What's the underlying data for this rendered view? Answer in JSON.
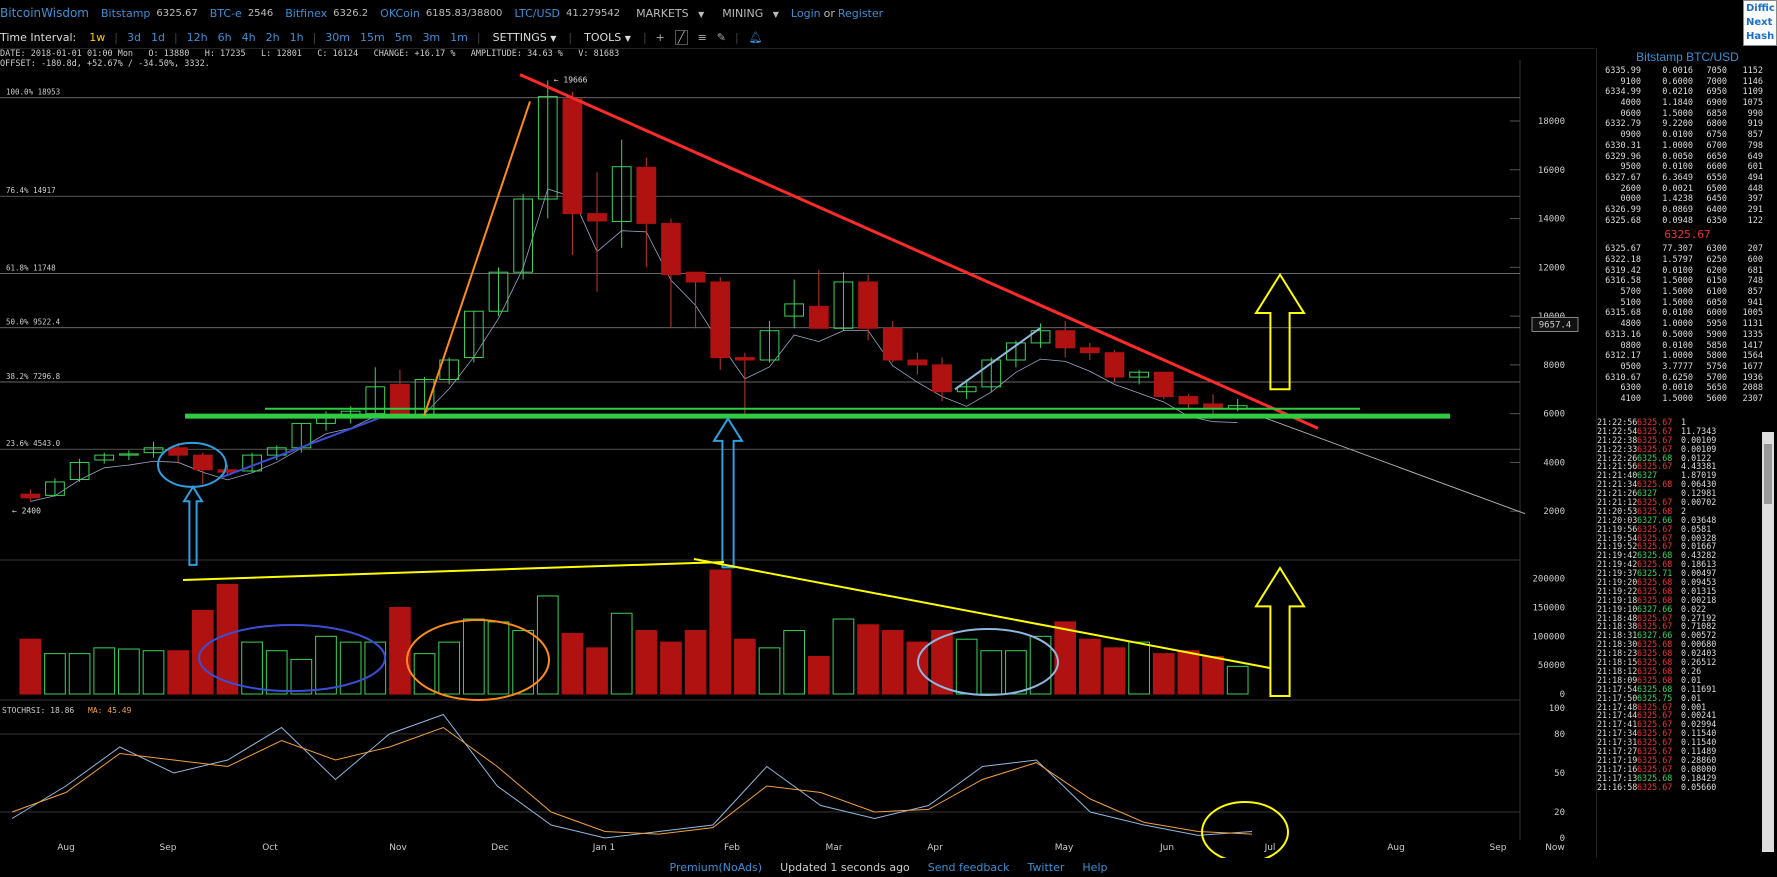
{
  "topbar": {
    "brand": "BitcoinWisdom",
    "tickers": [
      {
        "label": "Bitstamp",
        "value": "6325.67"
      },
      {
        "label": "BTC-e",
        "value": "2546"
      },
      {
        "label": "Bitfinex",
        "value": "6326.2"
      },
      {
        "label": "OKCoin",
        "value": "6185.83/38800"
      },
      {
        "label": "LTC/USD",
        "value": "41.279542"
      }
    ],
    "menu_markets": "MARKETS",
    "menu_mining": "MINING",
    "login": "Login",
    "or": "or",
    "register": "Register"
  },
  "corner": [
    "Diffic",
    "Next",
    "Hash"
  ],
  "toolbar": {
    "label": "Time Interval:",
    "intervals": [
      "1w",
      "3d",
      "1d",
      "12h",
      "6h",
      "4h",
      "2h",
      "1h",
      "30m",
      "15m",
      "5m",
      "3m",
      "1m"
    ],
    "selected": "1w",
    "settings": "SETTINGS",
    "tools": "TOOLS"
  },
  "info": {
    "line1": "DATE: 2018-01-01 01:00 Mon   O: 13880   H: 17235   L: 12801   C: 16124   CHANGE: +16.17 %   AMPLITUDE: 34.63 %   V: 81683",
    "line2": "OFFSET: -180.8d, +52.67% / -34.50%, 3332."
  },
  "chart_data": [
    {
      "type": "candlestick",
      "title": "Bitstamp BTC/USD 1w",
      "x_labels": [
        "Aug",
        "Sep",
        "Oct",
        "Nov",
        "Dec",
        "Jan 1",
        "Feb",
        "Mar",
        "Apr",
        "May",
        "Jun",
        "Jul",
        "Aug",
        "Sep",
        "Now"
      ],
      "y_ticks": [
        2000,
        4000,
        6000,
        8000,
        10000,
        12000,
        14000,
        16000,
        18000
      ],
      "ylim": [
        0,
        20500
      ],
      "max_label": "19666",
      "min_label": "2400",
      "current_price_tag": "9657.4",
      "fib_levels": [
        {
          "label": "100.0% 18953",
          "value": 18953
        },
        {
          "label": "76.4% 14917",
          "value": 14917
        },
        {
          "label": "61.8% 11748",
          "value": 11748
        },
        {
          "label": "50.0% 9522.4",
          "value": 9522.4
        },
        {
          "label": "38.2% 7296.8",
          "value": 7296.8
        },
        {
          "label": "23.6% 4543.0",
          "value": 4543.0
        }
      ],
      "candles": [
        {
          "o": 2700,
          "h": 2900,
          "l": 2400,
          "c": 2550
        },
        {
          "o": 2650,
          "h": 3350,
          "l": 2600,
          "c": 3200
        },
        {
          "o": 3300,
          "h": 4150,
          "l": 3200,
          "c": 4000
        },
        {
          "o": 4100,
          "h": 4400,
          "l": 3950,
          "c": 4300
        },
        {
          "o": 4300,
          "h": 4500,
          "l": 4100,
          "c": 4350
        },
        {
          "o": 4400,
          "h": 4850,
          "l": 4200,
          "c": 4600
        },
        {
          "o": 4600,
          "h": 4800,
          "l": 3950,
          "c": 4300
        },
        {
          "o": 4300,
          "h": 4400,
          "l": 3100,
          "c": 3700
        },
        {
          "o": 3700,
          "h": 3900,
          "l": 3500,
          "c": 3600
        },
        {
          "o": 3650,
          "h": 4400,
          "l": 3600,
          "c": 4300
        },
        {
          "o": 4300,
          "h": 4700,
          "l": 4100,
          "c": 4600
        },
        {
          "o": 4600,
          "h": 5600,
          "l": 4400,
          "c": 5600
        },
        {
          "o": 5600,
          "h": 6100,
          "l": 5300,
          "c": 5900
        },
        {
          "o": 5900,
          "h": 6300,
          "l": 5600,
          "c": 6100
        },
        {
          "o": 6000,
          "h": 7900,
          "l": 5900,
          "c": 7100
        },
        {
          "o": 7200,
          "h": 7800,
          "l": 5900,
          "c": 5900
        },
        {
          "o": 5900,
          "h": 7500,
          "l": 5800,
          "c": 7400
        },
        {
          "o": 7400,
          "h": 8300,
          "l": 7200,
          "c": 8200
        },
        {
          "o": 8300,
          "h": 10200,
          "l": 8100,
          "c": 10200
        },
        {
          "o": 10200,
          "h": 12000,
          "l": 10000,
          "c": 11800
        },
        {
          "o": 11800,
          "h": 15000,
          "l": 11500,
          "c": 14800
        },
        {
          "o": 14800,
          "h": 19666,
          "l": 14000,
          "c": 19000
        },
        {
          "o": 18900,
          "h": 19200,
          "l": 12500,
          "c": 14200
        },
        {
          "o": 14200,
          "h": 15900,
          "l": 11000,
          "c": 13900
        },
        {
          "o": 13880,
          "h": 17235,
          "l": 12801,
          "c": 16124
        },
        {
          "o": 16100,
          "h": 16500,
          "l": 12000,
          "c": 13800
        },
        {
          "o": 13800,
          "h": 14000,
          "l": 9500,
          "c": 11700
        },
        {
          "o": 11800,
          "h": 11800,
          "l": 9500,
          "c": 11400
        },
        {
          "o": 11400,
          "h": 11600,
          "l": 7800,
          "c": 8300
        },
        {
          "o": 8300,
          "h": 8500,
          "l": 6000,
          "c": 8200
        },
        {
          "o": 8200,
          "h": 9800,
          "l": 8100,
          "c": 9400
        },
        {
          "o": 10000,
          "h": 11500,
          "l": 9500,
          "c": 10500
        },
        {
          "o": 10400,
          "h": 11900,
          "l": 9600,
          "c": 9500
        },
        {
          "o": 9500,
          "h": 11800,
          "l": 9400,
          "c": 11400
        },
        {
          "o": 11400,
          "h": 11700,
          "l": 9000,
          "c": 9500
        },
        {
          "o": 9500,
          "h": 9800,
          "l": 8100,
          "c": 8200
        },
        {
          "o": 8200,
          "h": 8500,
          "l": 7600,
          "c": 8000
        },
        {
          "o": 8000,
          "h": 8300,
          "l": 6500,
          "c": 6900
        },
        {
          "o": 6900,
          "h": 7400,
          "l": 6600,
          "c": 7100
        },
        {
          "o": 7100,
          "h": 8300,
          "l": 6900,
          "c": 8200
        },
        {
          "o": 8200,
          "h": 9000,
          "l": 7900,
          "c": 8900
        },
        {
          "o": 8900,
          "h": 9700,
          "l": 8700,
          "c": 9400
        },
        {
          "o": 9400,
          "h": 9800,
          "l": 8300,
          "c": 8700
        },
        {
          "o": 8700,
          "h": 8900,
          "l": 8200,
          "c": 8500
        },
        {
          "o": 8500,
          "h": 8600,
          "l": 7300,
          "c": 7500
        },
        {
          "o": 7500,
          "h": 7800,
          "l": 7200,
          "c": 7700
        },
        {
          "o": 7700,
          "h": 7700,
          "l": 6600,
          "c": 6700
        },
        {
          "o": 6700,
          "h": 6800,
          "l": 6200,
          "c": 6400
        },
        {
          "o": 6400,
          "h": 6800,
          "l": 5800,
          "c": 6200
        },
        {
          "o": 6200,
          "h": 6600,
          "l": 6100,
          "c": 6325
        }
      ],
      "volume": {
        "y_ticks": [
          0,
          50000,
          100000,
          150000,
          200000
        ],
        "ylim": [
          0,
          215000
        ],
        "bars": [
          95000,
          70000,
          70000,
          80000,
          78000,
          75000,
          75000,
          145000,
          190000,
          90000,
          75000,
          60000,
          100000,
          90000,
          90000,
          150000,
          70000,
          90000,
          130000,
          125000,
          110000,
          170000,
          105000,
          80000,
          140000,
          110000,
          90000,
          110000,
          215000,
          95000,
          80000,
          110000,
          65000,
          130000,
          120000,
          110000,
          90000,
          110000,
          95000,
          75000,
          75000,
          100000,
          125000,
          95000,
          80000,
          90000,
          70000,
          75000,
          65000,
          48000
        ]
      },
      "stochrsi": {
        "label": "STOCHRSI: 18.86",
        "ma_label": "MA: 45.49",
        "y_ticks": [
          0,
          20,
          50,
          80,
          100
        ],
        "k": [
          15,
          40,
          70,
          50,
          60,
          85,
          45,
          80,
          95,
          40,
          10,
          0,
          5,
          10,
          55,
          25,
          15,
          25,
          55,
          60,
          20,
          10,
          2,
          5
        ],
        "d": [
          20,
          35,
          65,
          60,
          55,
          75,
          60,
          70,
          85,
          55,
          20,
          5,
          3,
          8,
          40,
          35,
          20,
          22,
          45,
          58,
          30,
          12,
          5,
          3
        ]
      }
    }
  ],
  "right_panel": {
    "title": "Bitstamp BTC/USD",
    "asks": [
      [
        "6335.99",
        "0.0016",
        "7050",
        "1152"
      ],
      [
        "9100",
        "0.6000",
        "7000",
        "1146"
      ],
      [
        "6334.99",
        "0.0210",
        "6950",
        "1109"
      ],
      [
        "4000",
        "1.1840",
        "6900",
        "1075"
      ],
      [
        "0600",
        "1.5000",
        "6850",
        "990"
      ],
      [
        "6332.79",
        "9.2200",
        "6800",
        "919"
      ],
      [
        "0900",
        "0.0100",
        "6750",
        "857"
      ],
      [
        "6330.31",
        "1.0000",
        "6700",
        "798"
      ],
      [
        "6329.96",
        "0.0050",
        "6650",
        "649"
      ],
      [
        "9500",
        "0.0100",
        "6600",
        "601"
      ],
      [
        "6327.67",
        "6.3649",
        "6550",
        "494"
      ],
      [
        "2600",
        "0.0021",
        "6500",
        "448"
      ],
      [
        "0000",
        "1.4238",
        "6450",
        "397"
      ],
      [
        "6326.99",
        "0.0869",
        "6400",
        "291"
      ],
      [
        "6325.68",
        "0.0948",
        "6350",
        "122"
      ]
    ],
    "last_price": "6325.67",
    "bids": [
      [
        "6325.67",
        "77.307",
        "6300",
        "207"
      ],
      [
        "6322.18",
        "1.5797",
        "6250",
        "600"
      ],
      [
        "6319.42",
        "0.0100",
        "6200",
        "681"
      ],
      [
        "6316.58",
        "1.5000",
        "6150",
        "748"
      ],
      [
        "5700",
        "1.5000",
        "6100",
        "857"
      ],
      [
        "5100",
        "1.5000",
        "6050",
        "941"
      ],
      [
        "6315.68",
        "0.0100",
        "6000",
        "1005"
      ],
      [
        "4800",
        "1.0000",
        "5950",
        "1131"
      ],
      [
        "6313.16",
        "0.5000",
        "5900",
        "1335"
      ],
      [
        "0800",
        "0.0100",
        "5850",
        "1417"
      ],
      [
        "6312.17",
        "1.0000",
        "5800",
        "1564"
      ],
      [
        "0500",
        "3.7777",
        "5750",
        "1677"
      ],
      [
        "6310.67",
        "0.6250",
        "5700",
        "1936"
      ],
      [
        "6300",
        "0.0010",
        "5650",
        "2088"
      ],
      [
        "4100",
        "1.5000",
        "5600",
        "2307"
      ]
    ],
    "trades": [
      [
        "21:22:56",
        "6325.67",
        "1",
        "dn"
      ],
      [
        "21:22:54",
        "6325.67",
        "11.7343",
        "dn"
      ],
      [
        "21:22:38",
        "6325.67",
        "0.00109",
        "dn"
      ],
      [
        "21:22:33",
        "6325.67",
        "0.00109",
        "dn"
      ],
      [
        "21:22:26",
        "6325.68",
        "0.0122",
        "up"
      ],
      [
        "21:21:56",
        "6325.67",
        "4.43381",
        "dn"
      ],
      [
        "21:21:40",
        "6327",
        "1.87019",
        "up"
      ],
      [
        "21:21:34",
        "6325.68",
        "0.06430",
        "dn"
      ],
      [
        "21:21:26",
        "6327",
        "0.12981",
        "up"
      ],
      [
        "21:21:12",
        "6325.67",
        "0.00702",
        "dn"
      ],
      [
        "21:20:53",
        "6325.68",
        "2",
        "dn"
      ],
      [
        "21:20:03",
        "6327.66",
        "0.03648",
        "up"
      ],
      [
        "21:19:56",
        "6325.67",
        "0.0581",
        "dn"
      ],
      [
        "21:19:54",
        "6325.67",
        "0.00328",
        "dn"
      ],
      [
        "21:19:52",
        "6325.67",
        "0.01667",
        "dn"
      ],
      [
        "21:19:42",
        "6325.68",
        "0.43282",
        "up"
      ],
      [
        "21:19:42",
        "6325.68",
        "0.18613",
        "dn"
      ],
      [
        "21:19:37",
        "6325.71",
        "0.00497",
        "up"
      ],
      [
        "21:19:20",
        "6325.68",
        "0.09453",
        "dn"
      ],
      [
        "21:19:22",
        "6325.68",
        "0.01315",
        "dn"
      ],
      [
        "21:19:18",
        "6325.68",
        "0.00218",
        "dn"
      ],
      [
        "21:19:10",
        "6327.66",
        "0.022",
        "up"
      ],
      [
        "21:18:48",
        "6325.67",
        "0.27192",
        "dn"
      ],
      [
        "21:18:38",
        "6325.67",
        "0.71082",
        "dn"
      ],
      [
        "21:18:31",
        "6327.66",
        "0.00572",
        "up"
      ],
      [
        "21:18:30",
        "6325.68",
        "0.00680",
        "dn"
      ],
      [
        "21:18:23",
        "6325.68",
        "0.02403",
        "dn"
      ],
      [
        "21:18:15",
        "6325.68",
        "0.26512",
        "dn"
      ],
      [
        "21:18:12",
        "6325.68",
        "0.26",
        "dn"
      ],
      [
        "21:18:09",
        "6325.68",
        "0.01",
        "dn"
      ],
      [
        "21:17:54",
        "6325.68",
        "0.11691",
        "up"
      ],
      [
        "21:17:50",
        "6325.75",
        "0.01",
        "up"
      ],
      [
        "21:17:48",
        "6325.67",
        "0.001",
        "dn"
      ],
      [
        "21:17:44",
        "6325.67",
        "0.00241",
        "dn"
      ],
      [
        "21:17:41",
        "6325.67",
        "0.02994",
        "dn"
      ],
      [
        "21:17:34",
        "6325.67",
        "0.11540",
        "dn"
      ],
      [
        "21:17:31",
        "6325.67",
        "0.11540",
        "dn"
      ],
      [
        "21:17:27",
        "6325.67",
        "0.11489",
        "dn"
      ],
      [
        "21:17:19",
        "6325.67",
        "0.28860",
        "dn"
      ],
      [
        "21:17:16",
        "6325.67",
        "0.08000",
        "dn"
      ],
      [
        "21:17:13",
        "6325.68",
        "0.18429",
        "up"
      ],
      [
        "21:16:58",
        "6325.67",
        "0.05660",
        "dn"
      ]
    ]
  },
  "footer": {
    "premium": "Premium(NoAds)",
    "updated": "Updated 1 seconds ago",
    "feedback": "Send feedback",
    "twitter": "Twitter",
    "help": "Help"
  },
  "colors": {
    "up": "#3bd35a",
    "down": "#b01212",
    "link": "#3b8fd6",
    "trend_red": "#ff2b2b",
    "support_green": "#2ecc40",
    "annotation_yellow": "#ffff00"
  }
}
